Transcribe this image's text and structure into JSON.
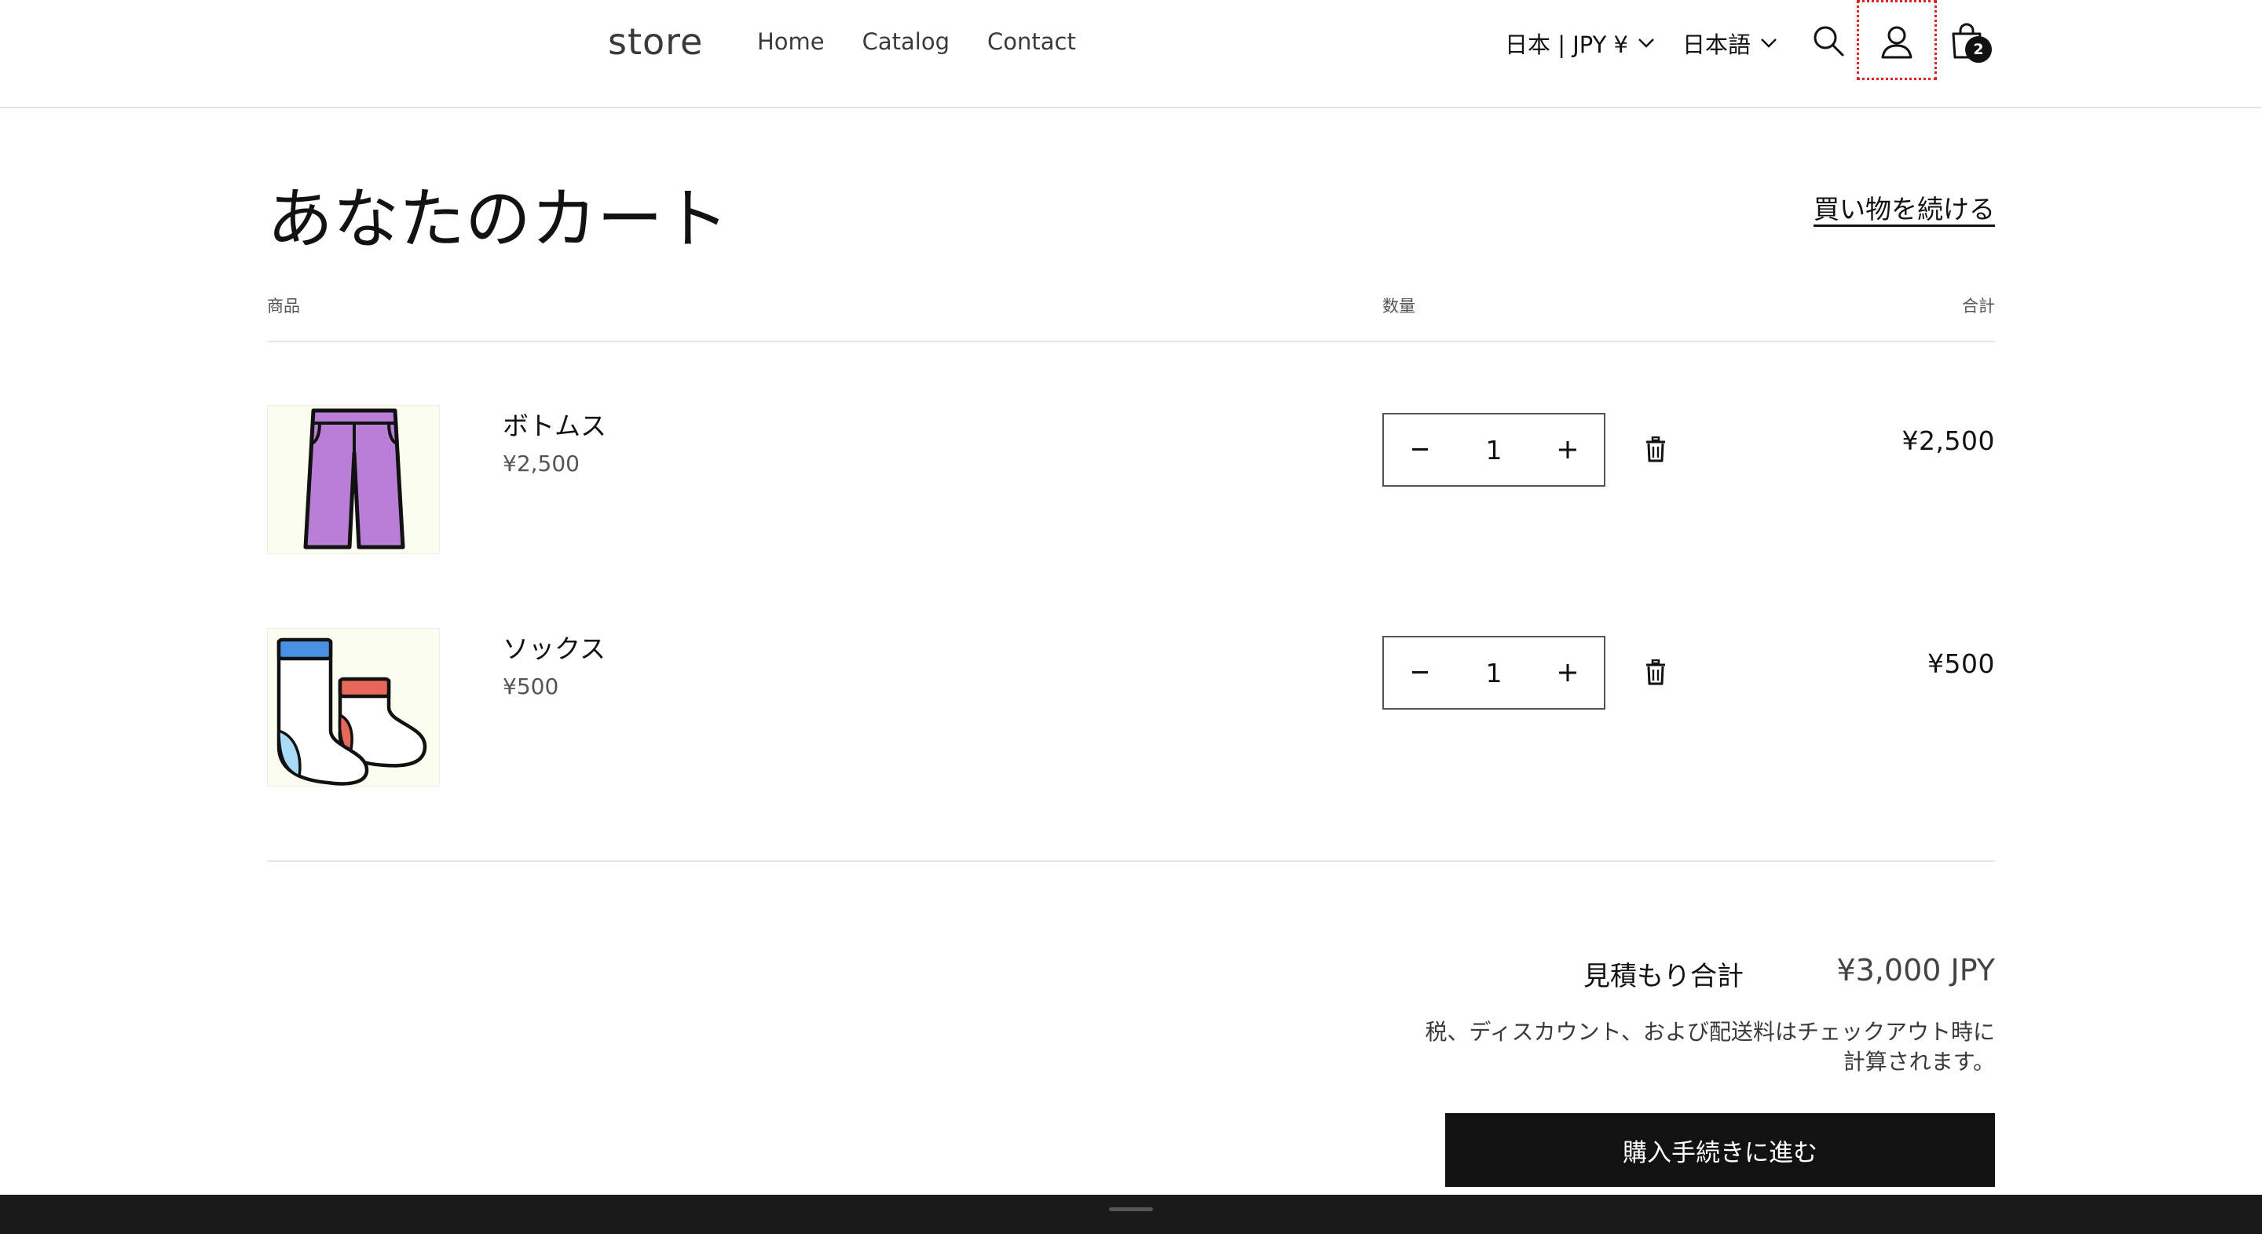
{
  "header": {
    "logo": "store",
    "nav": [
      "Home",
      "Catalog",
      "Contact"
    ],
    "country_selector": "日本 | JPY ¥",
    "language_selector": "日本語",
    "cart_count": "2"
  },
  "cart": {
    "title": "あなたのカート",
    "continue_shopping": "買い物を続ける",
    "columns": {
      "product": "商品",
      "quantity": "数量",
      "total": "合計"
    },
    "items": [
      {
        "name": "ボトムス",
        "price": "¥2,500",
        "quantity": "1",
        "line_total": "¥2,500"
      },
      {
        "name": "ソックス",
        "price": "¥500",
        "quantity": "1",
        "line_total": "¥500"
      }
    ],
    "subtotal_label": "見積もり合計",
    "subtotal_value": "¥3,000 JPY",
    "tax_note_line1": "税、ディスカウント、および配送料はチェックアウト時に",
    "tax_note_line2": "計算されます。",
    "checkout_button": "購入手続きに進む"
  },
  "colors": {
    "primary": "#121212",
    "thumb_bg": "#fbfdf0",
    "pants": "#b97fd6",
    "sock_blue": "#4a90e2",
    "sock_red": "#e8675a",
    "focus_outline": "#dd2222"
  }
}
